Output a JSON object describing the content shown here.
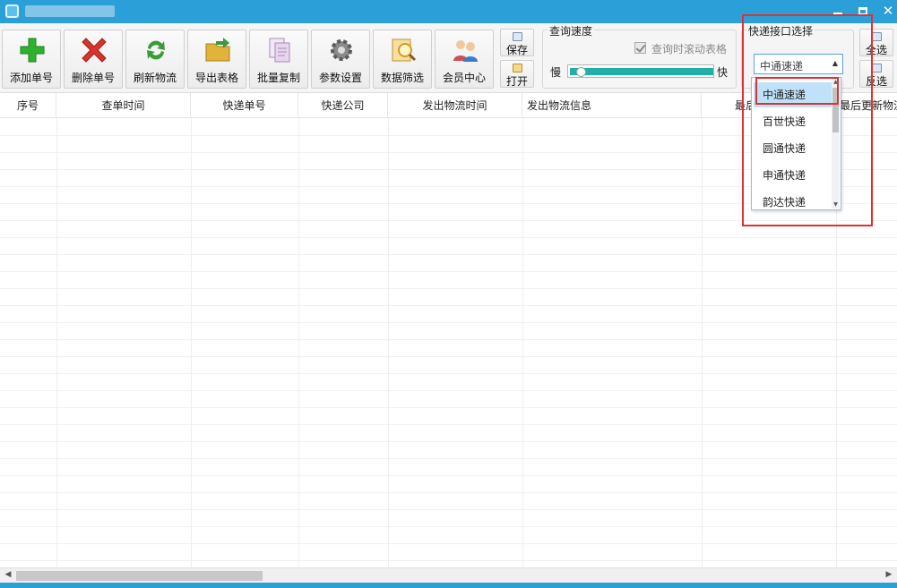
{
  "window": {
    "title": ""
  },
  "toolbar": {
    "buttons": [
      {
        "label": "添加单号",
        "icon": "add-icon",
        "color": "#2fb02f"
      },
      {
        "label": "删除单号",
        "icon": "delete-icon",
        "color": "#d8342c"
      },
      {
        "label": "刷新物流",
        "icon": "refresh-icon",
        "color": "#3a9b3a"
      },
      {
        "label": "导出表格",
        "icon": "folder-export-icon",
        "color": "#e2b33a"
      },
      {
        "label": "批量复制",
        "icon": "copy-icon",
        "color": "#c9a6d6"
      },
      {
        "label": "参数设置",
        "icon": "gear-icon",
        "color": "#8a8a8a"
      },
      {
        "label": "数据筛选",
        "icon": "magnifier-icon",
        "color": "#e8b540"
      },
      {
        "label": "会员中心",
        "icon": "users-icon",
        "color": "#d05050"
      }
    ],
    "save_label": "保存",
    "open_label": "打开"
  },
  "speed": {
    "group_label": "查询速度",
    "scroll_checkbox_label": "查询时滚动表格",
    "scroll_checked": true,
    "slow_label": "慢",
    "fast_label": "快",
    "level": 0.05
  },
  "api": {
    "group_label": "快递接口选择",
    "selected": "中通速递",
    "options": [
      "中通速递",
      "百世快递",
      "圆通快递",
      "申通快递",
      "韵达快递"
    ],
    "select_all_label": "全选",
    "invert_label": "反选"
  },
  "table": {
    "columns": [
      "序号",
      "查单时间",
      "快递单号",
      "快递公司",
      "发出物流时间",
      "发出物流信息",
      "最后",
      "最后更新物流"
    ]
  }
}
